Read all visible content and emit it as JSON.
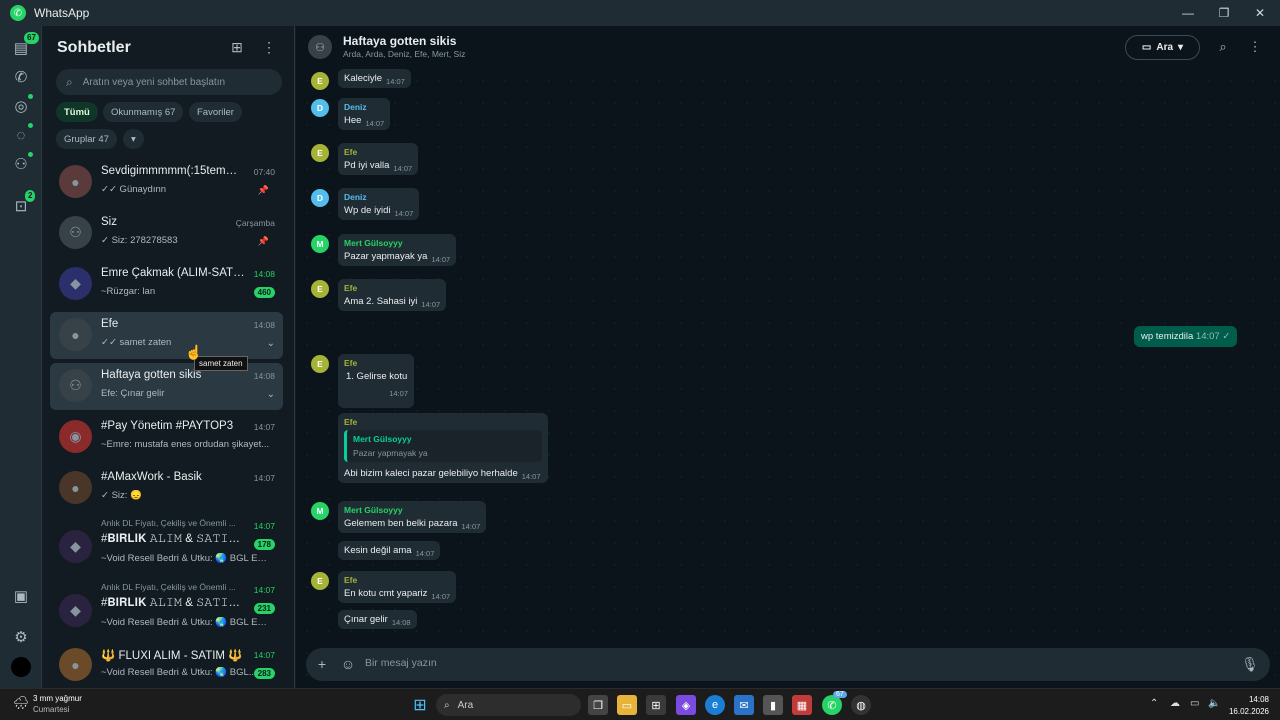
{
  "window": {
    "title": "WhatsApp",
    "minimize": "—",
    "maximize": "❐",
    "close": "✕"
  },
  "rail": {
    "chats_badge": "67",
    "updates_badge": "2",
    "icons": [
      "chats-icon",
      "calls-icon",
      "status-icon",
      "channels-icon",
      "communities-icon",
      "archive-icon",
      "media-icon",
      "settings-icon",
      "profile-avatar"
    ]
  },
  "sidebar": {
    "title": "Sohbetler",
    "search_placeholder": "Aratın veya yeni sohbet başlatın",
    "filters": [
      {
        "label": "Tümü",
        "active": true
      },
      {
        "label": "Okunmamış 67",
        "active": false
      },
      {
        "label": "Favoriler",
        "active": false
      },
      {
        "label": "Gruplar 47",
        "active": false
      },
      {
        "label": "▾",
        "active": false
      }
    ],
    "chats": [
      {
        "name": "Sevdigimmmmm(:15temmuz",
        "time": "07:40",
        "preview": "✓✓ Günaydınn",
        "pinned": "📌"
      },
      {
        "name": "Siz",
        "time": "Çarşamba",
        "preview": "✓ Siz: 278278583",
        "pinned": "📌"
      },
      {
        "name": "Emre Çakmak (ALIM-SATIM) ...",
        "time": "14:08",
        "preview": "~Rüzgar: lan",
        "unread": "460"
      },
      {
        "name": "Efe",
        "time": "14:08",
        "preview": "✓✓ samet zaten",
        "chevron": "⌄"
      },
      {
        "name": "Haftaya gotten sikis",
        "time": "14:08",
        "preview": "Efe: Çınar gelir",
        "chevron": "⌄"
      },
      {
        "name": "#Pay Yönetim #PAYTOP3",
        "time": "14:07",
        "preview": "~Emre: mustafa enes ordudan şikayet..."
      },
      {
        "name": "#AMaxWork - Basik",
        "time": "14:07",
        "preview": "✓ Siz: 😞"
      },
      {
        "super": "Anlık DL Fiyatı, Çekiliş ve Önemli ...",
        "name": "#𝐁𝐈𝐑𝐋𝐈𝐊 𝙰𝙻𝙸𝙼 & 𝚂𝙰𝚃𝙸𝙼 #3 ...",
        "time": "14:07",
        "preview": "~Void Resell Bedri & Utku: 🌏 BGL EN D...",
        "unread": "178"
      },
      {
        "super": "Anlık DL Fiyatı, Çekiliş ve Önemli ...",
        "name": "#𝐁𝐈𝐑𝐋𝐈𝐊 𝙰𝙻𝙸𝙼 & 𝚂𝙰𝚃𝙸𝙼 #1 ...",
        "time": "14:07",
        "preview": "~Void Resell Bedri & Utku: 🌏 BGL EN D...",
        "unread": "231"
      },
      {
        "name": "🔱 FLUXI ALIM - SATIM 🔱",
        "time": "14:07",
        "preview": "~Void Resell Bedri & Utku: 🌏 BGL...",
        "unread": "283"
      }
    ],
    "tooltip": "samet zaten"
  },
  "conversation": {
    "name": "Haftaya gotten sikis",
    "members": "Arda, Arda, Deniz, Efe, Mert, Siz",
    "call_label": "Ara",
    "messages": [
      {
        "sender": "",
        "initial": "E",
        "color": "#a5b337",
        "text": "Kaleciyle",
        "time": "14:07"
      },
      {
        "sender": "Deniz",
        "initial": "D",
        "color": "#53bdeb",
        "text": "Hee",
        "time": "14:07"
      },
      {
        "sender": "Efe",
        "initial": "E",
        "color": "#a5b337",
        "text": "Pd iyi valla",
        "time": "14:07"
      },
      {
        "sender": "Deniz",
        "initial": "D",
        "color": "#53bdeb",
        "text": "Wp de iyidi",
        "time": "14:07"
      },
      {
        "sender": "Mert Gülsoyyy",
        "initial": "M",
        "color": "#25d366",
        "text": "Pazar yapmayak ya",
        "time": "14:07"
      },
      {
        "sender": "Efe",
        "initial": "E",
        "color": "#a5b337",
        "text": "Ama 2. Sahasi iyi",
        "time": "14:07"
      },
      {
        "sender": "Efe",
        "initial": "E",
        "color": "#a5b337",
        "text": "1.  Gelirse kotu",
        "time": "14:07"
      },
      {
        "sender": "Efe",
        "text": "Abi bizim kaleci pazar gelebiliyo herhalde",
        "time": "14:07",
        "quote_name": "Mert Gülsoyyy",
        "quote_text": "Pazar yapmayak ya"
      },
      {
        "sender": "Mert Gülsoyyy",
        "initial": "M",
        "color": "#25d366",
        "text": "Gelemem ben belki pazara",
        "time": "14:07"
      },
      {
        "sender": "",
        "text": "Kesin değil ama",
        "time": "14:07"
      },
      {
        "sender": "Efe",
        "initial": "E",
        "color": "#a5b337",
        "text": "En kotu cmt yapariz",
        "time": "14:07"
      },
      {
        "sender": "",
        "text": "Çınar gelir",
        "time": "14:08"
      }
    ],
    "outgoing": {
      "text": "wp temizdila",
      "time": "14:07 ✓"
    },
    "composer_placeholder": "Bir mesaj yazın"
  },
  "taskbar": {
    "weather_title": "3 mm yağmur",
    "weather_sub": "Cumartesi",
    "search_label": "Ara",
    "whatsapp_badge": "67",
    "clock_time": "14:08",
    "clock_date": "16.02.2026"
  }
}
